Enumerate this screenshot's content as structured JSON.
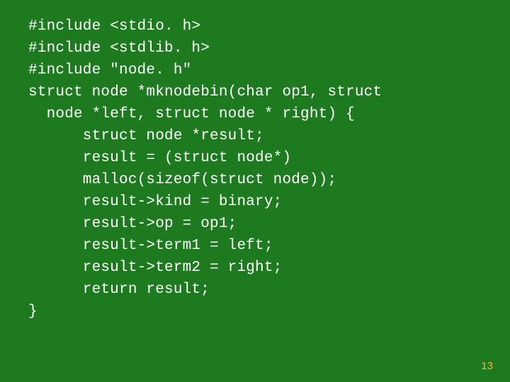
{
  "code": {
    "lines": [
      "#include <stdio. h>",
      "#include <stdlib. h>",
      "#include \"node. h\"",
      "struct node *mknodebin(char op1, struct",
      "  node *left, struct node * right) {",
      "      struct node *result;",
      "      result = (struct node*)",
      "      malloc(sizeof(struct node));",
      "      result->kind = binary;",
      "      result->op = op1;",
      "      result->term1 = left;",
      "      result->term2 = right;",
      "      return result;",
      "}"
    ]
  },
  "page_number": "13"
}
